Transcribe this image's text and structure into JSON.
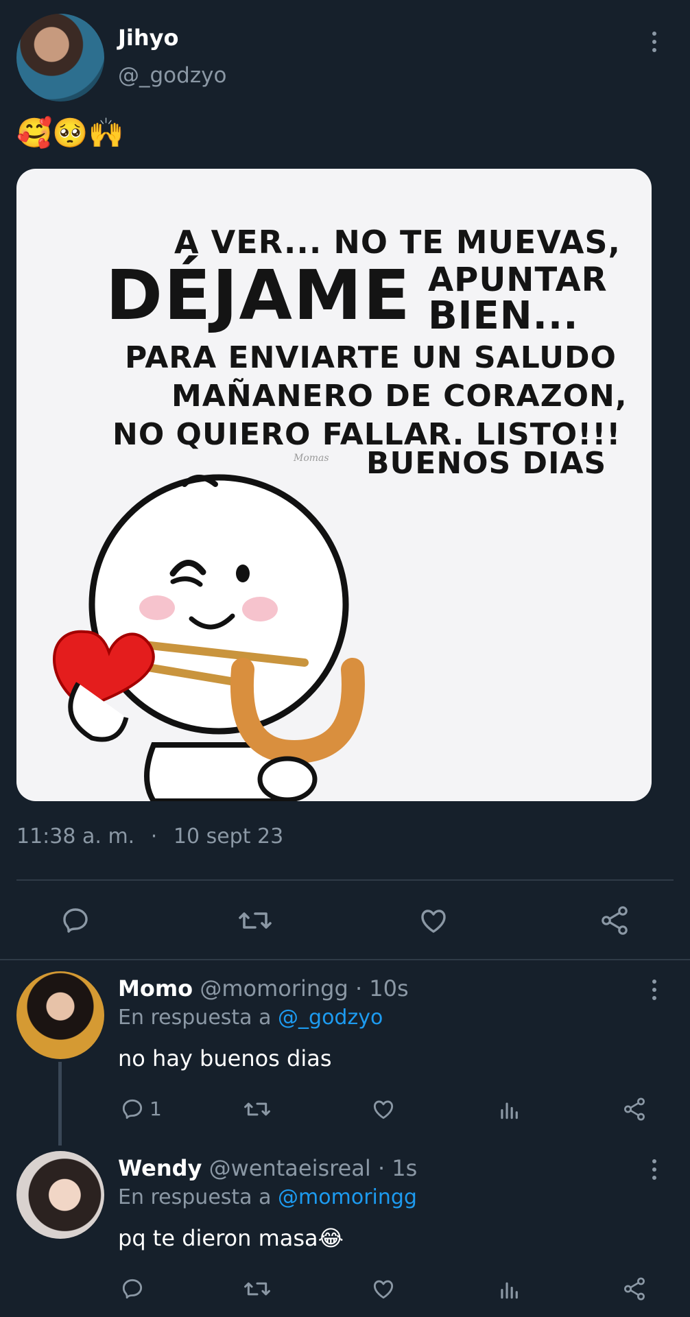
{
  "tweet": {
    "author_name": "Jihyo",
    "author_handle": "@_godzyo",
    "text": "🥰🥺🙌",
    "time": "11:38 a. m.",
    "separator": "·",
    "date": "10 sept 23",
    "meme": {
      "line1": "A VER... NO TE MUEVAS,",
      "big": "DÉJAME",
      "line2a": "APUNTAR",
      "line2b": "BIEN...",
      "line3": "PARA ENVIARTE UN SALUDO",
      "line4": "MAÑANERO DE CORAZON,",
      "line5": "NO QUIERO FALLAR. LISTO!!!",
      "signature": "Momas",
      "line6": "BUENOS DIAS"
    }
  },
  "replies": [
    {
      "name": "Momo",
      "handle": "@momoringg",
      "time": "· 10s",
      "reply_prefix": "En respuesta a",
      "reply_to": "@_godzyo",
      "text": "no hay buenos dias",
      "reply_count": "1"
    },
    {
      "name": "Wendy",
      "handle": "@wentaeisreal",
      "time": "· 1s",
      "reply_prefix": "En respuesta a",
      "reply_to": "@momoringg",
      "text": "pq te dieron masa😂",
      "reply_count": ""
    }
  ],
  "colors": {
    "background": "#16202b",
    "muted": "#8b98a5",
    "link": "#1d9bf0",
    "divider": "#2f3b47"
  }
}
